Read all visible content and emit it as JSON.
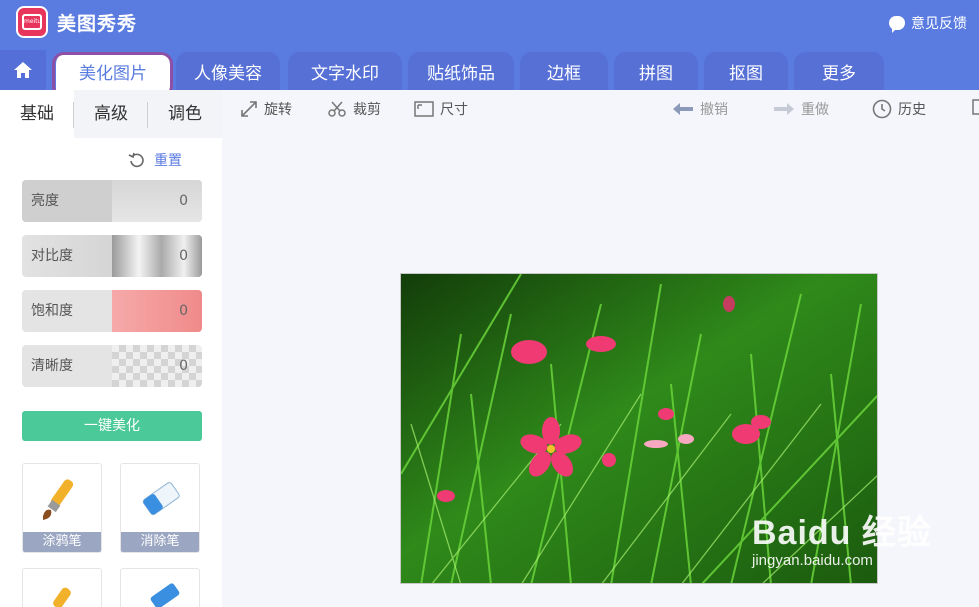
{
  "app": {
    "title": "美图秀秀",
    "feedback_label": "意见反馈"
  },
  "tabs": [
    {
      "label": "美化图片",
      "active": true
    },
    {
      "label": "人像美容"
    },
    {
      "label": "文字水印"
    },
    {
      "label": "贴纸饰品"
    },
    {
      "label": "边框"
    },
    {
      "label": "拼图"
    },
    {
      "label": "抠图"
    },
    {
      "label": "更多"
    }
  ],
  "subtabs": [
    {
      "label": "基础",
      "active": true
    },
    {
      "label": "高级"
    },
    {
      "label": "调色"
    }
  ],
  "reset_label": "重置",
  "sliders": [
    {
      "label": "亮度",
      "value": "0"
    },
    {
      "label": "对比度",
      "value": "0"
    },
    {
      "label": "饱和度",
      "value": "0"
    },
    {
      "label": "清晰度",
      "value": "0"
    }
  ],
  "onekey_label": "一键美化",
  "tools": [
    {
      "label": "涂鸦笔"
    },
    {
      "label": "消除笔"
    }
  ],
  "toolbar": {
    "rotate": "旋转",
    "crop": "裁剪",
    "size": "尺寸",
    "undo": "撤销",
    "redo": "重做",
    "history": "历史"
  },
  "watermark": {
    "brand": "Baidu 经验",
    "url": "jingyan.baidu.com"
  },
  "colors": {
    "accent": "#5a7be0",
    "tab_highlight": "#8e4fa6",
    "onekey": "#4cc999"
  }
}
